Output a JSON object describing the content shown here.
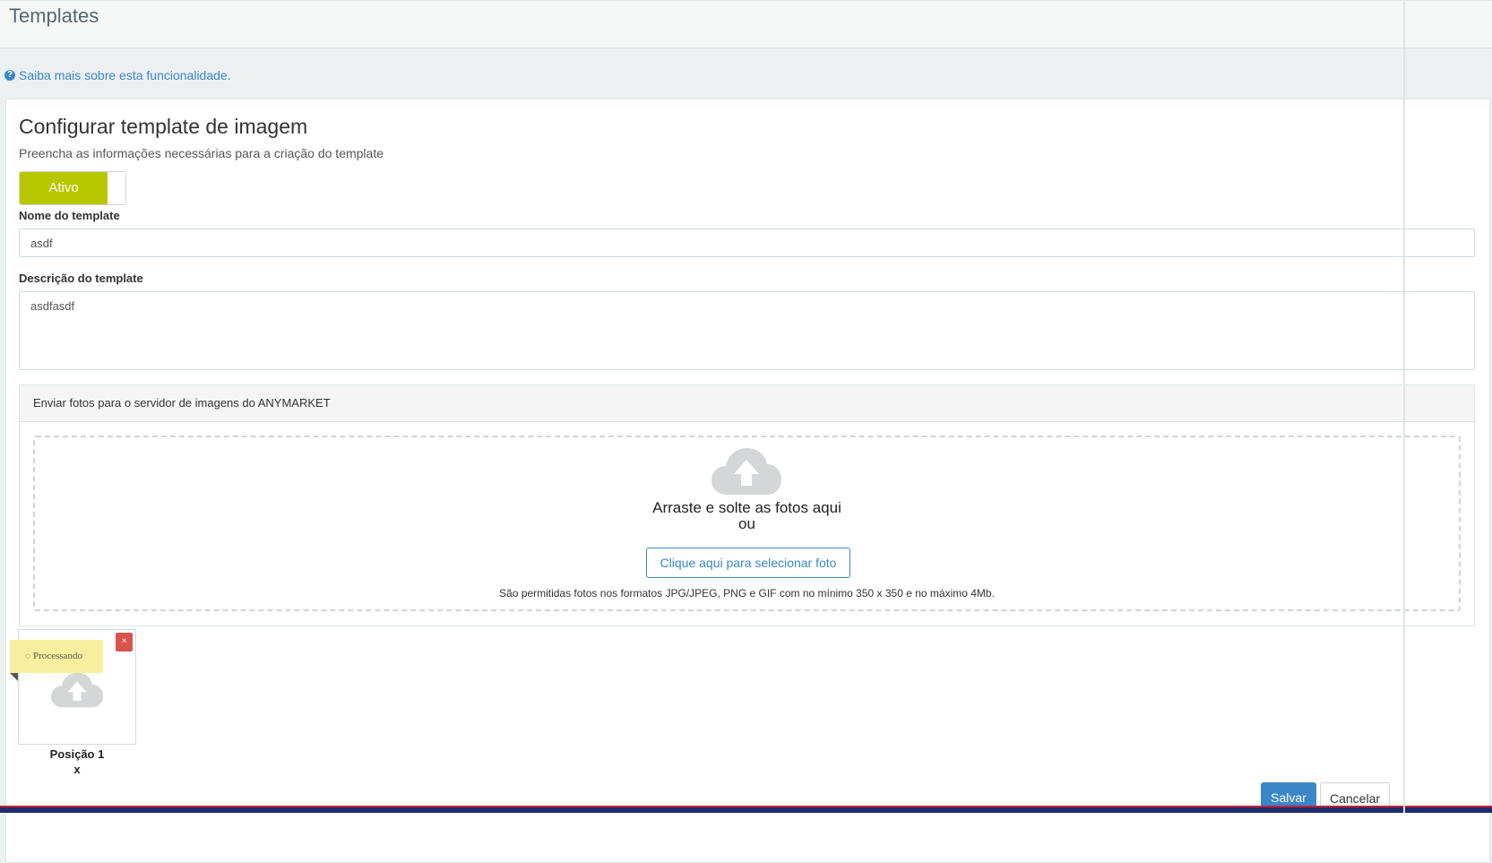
{
  "header": {
    "title": "Templates"
  },
  "help": {
    "icon": "question-circle-icon",
    "link_text": "Saiba mais sobre esta funcionalidade."
  },
  "form": {
    "title": "Configurar template de imagem",
    "subtitle": "Preencha as informações necessárias para a criação do template",
    "toggle_label": "Ativo",
    "toggle_color": "#b7c800",
    "name_label": "Nome do template",
    "name_value": "asdf",
    "description_label": "Descrição do template",
    "description_value": "asdfasdf"
  },
  "upload": {
    "header": "Enviar fotos para o servidor de imagens do ANYMARKET",
    "icon": "cloud-upload-icon",
    "drop_text": "Arraste e solte as fotos aqui",
    "or_text": "ou",
    "select_button": "Clique aqui para selecionar foto",
    "hint": "São permitidas fotos nos formatos JPG/JPEG, PNG e GIF com no mínimo 350 x 350 e no máximo 4Mb."
  },
  "thumbnail": {
    "close_label": "×",
    "status": "Processando",
    "position_label": "Posição 1",
    "position_remove": "x"
  },
  "actions": {
    "save": "Salvar",
    "cancel": "Cancelar",
    "save_color": "#3a87c8"
  }
}
